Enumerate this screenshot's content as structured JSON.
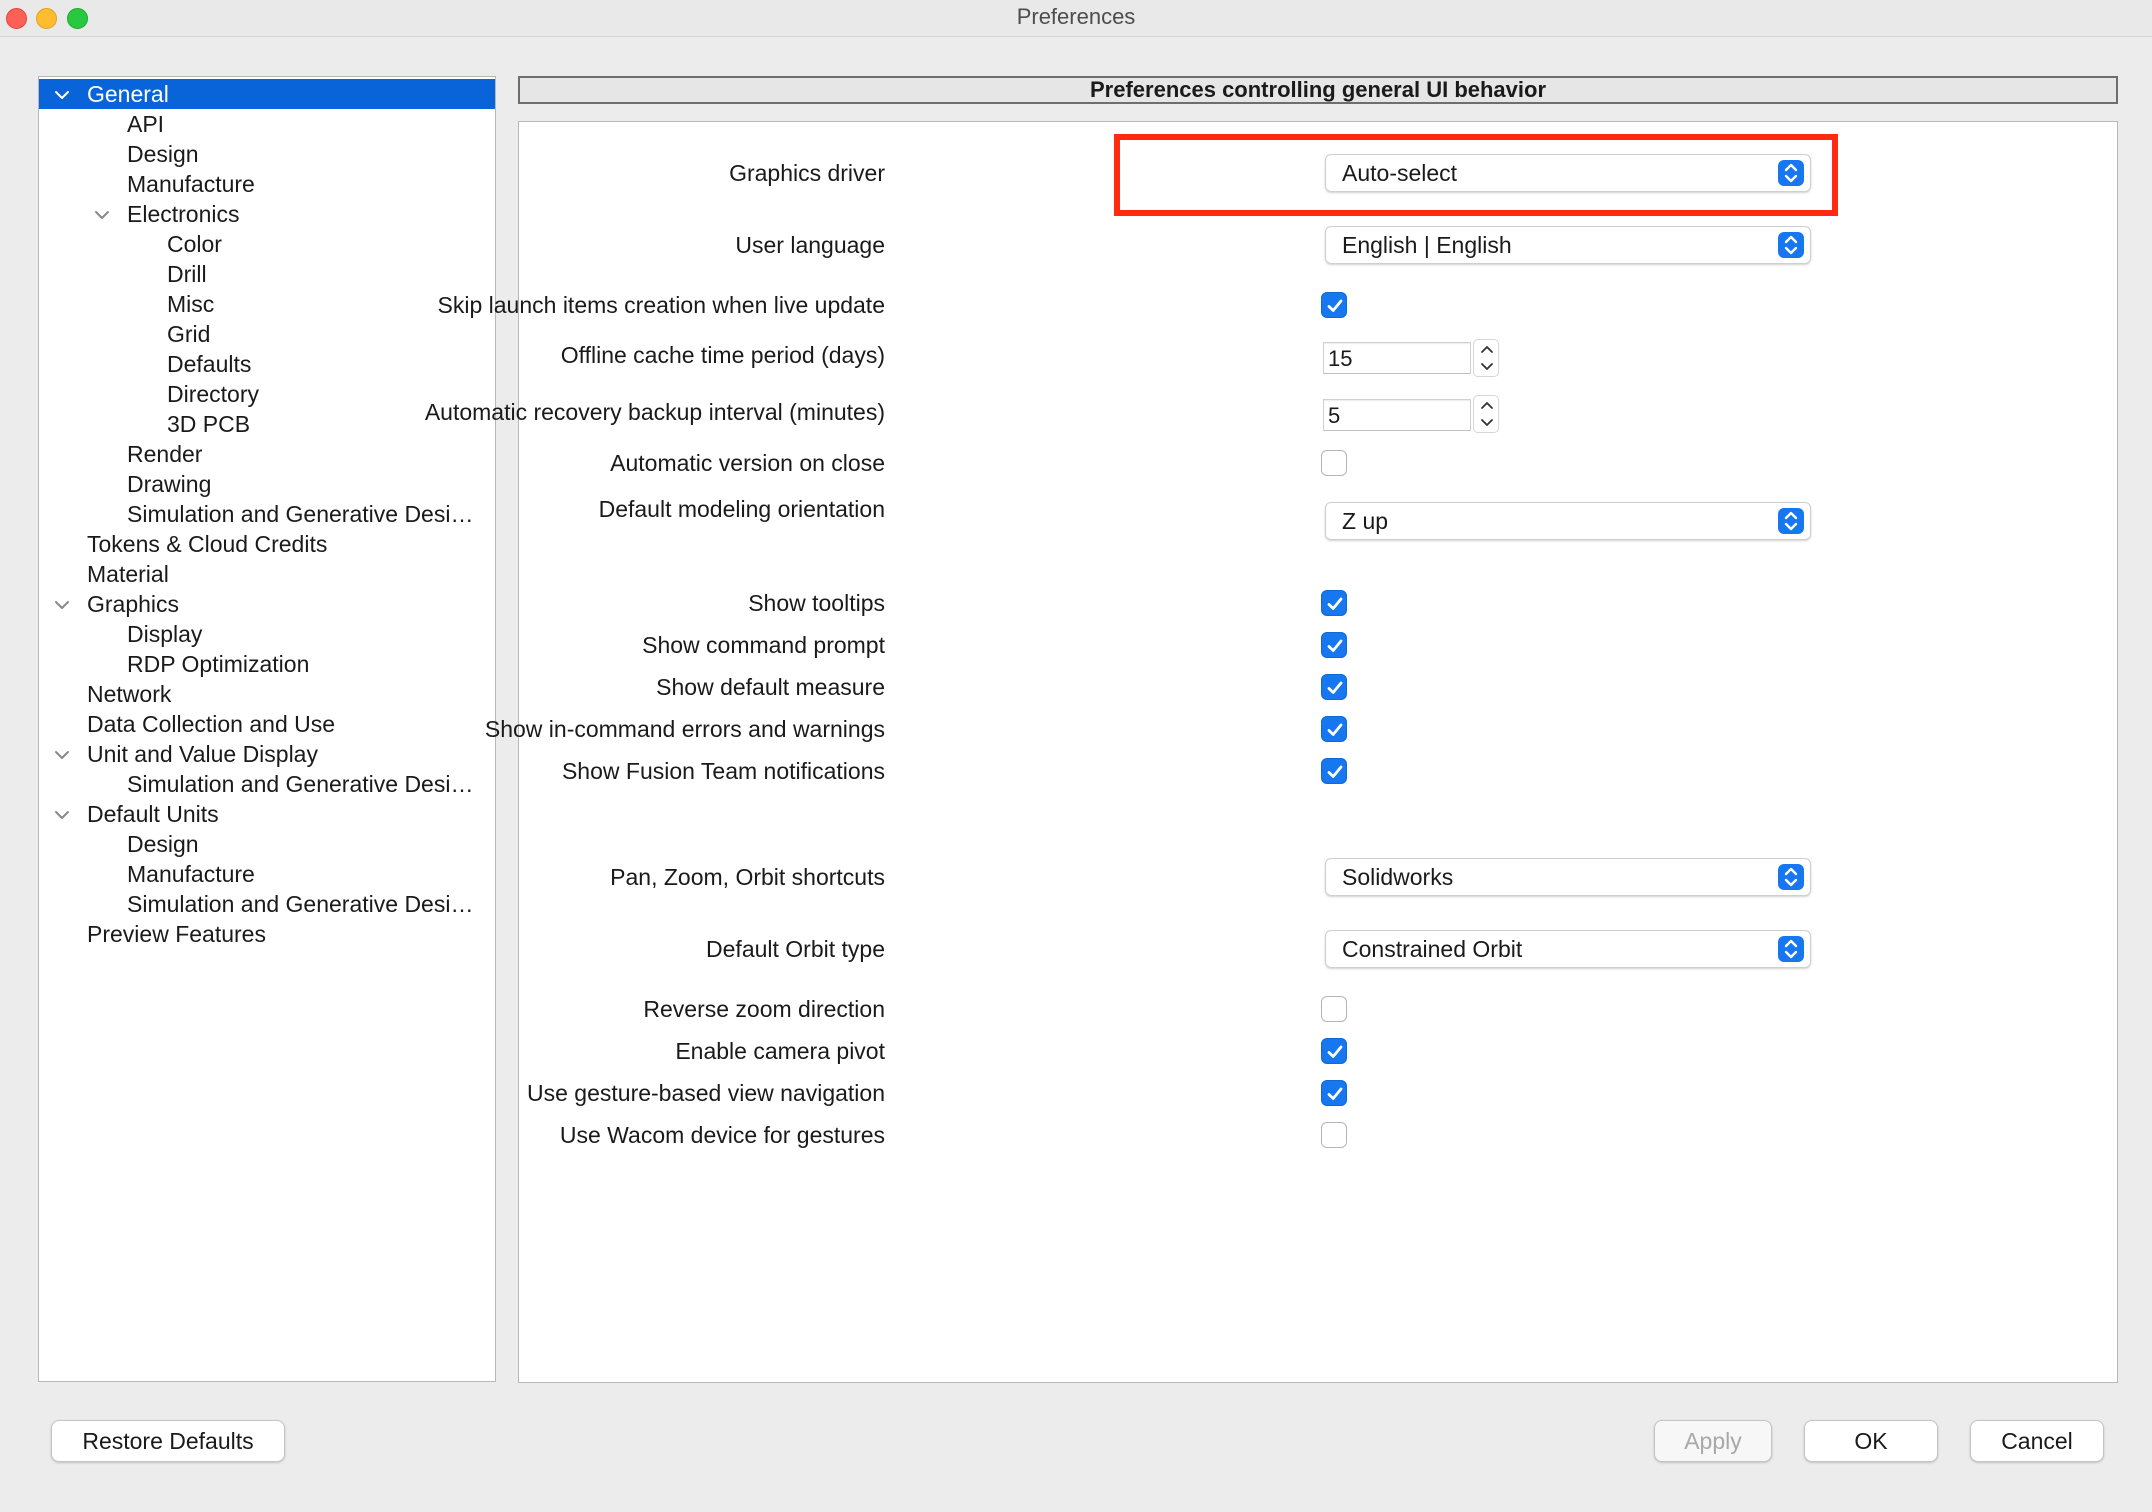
{
  "window": {
    "title": "Preferences",
    "controls": [
      "close-icon",
      "minimize-icon",
      "zoom-icon"
    ]
  },
  "tree": {
    "items": [
      {
        "label": "General",
        "level": 0,
        "expanded": true,
        "selected": true
      },
      {
        "label": "API",
        "level": 1
      },
      {
        "label": "Design",
        "level": 1
      },
      {
        "label": "Manufacture",
        "level": 1
      },
      {
        "label": "Electronics",
        "level": 1,
        "expanded": true
      },
      {
        "label": "Color",
        "level": 2
      },
      {
        "label": "Drill",
        "level": 2
      },
      {
        "label": "Misc",
        "level": 2
      },
      {
        "label": "Grid",
        "level": 2
      },
      {
        "label": "Defaults",
        "level": 2
      },
      {
        "label": "Directory",
        "level": 2
      },
      {
        "label": "3D PCB",
        "level": 2
      },
      {
        "label": "Render",
        "level": 1
      },
      {
        "label": "Drawing",
        "level": 1
      },
      {
        "label": "Simulation and Generative Desi…",
        "level": 1
      },
      {
        "label": "Tokens & Cloud Credits",
        "level": 0
      },
      {
        "label": "Material",
        "level": 0
      },
      {
        "label": "Graphics",
        "level": 0,
        "expanded": true
      },
      {
        "label": "Display",
        "level": 1
      },
      {
        "label": "RDP Optimization",
        "level": 1
      },
      {
        "label": "Network",
        "level": 0
      },
      {
        "label": "Data Collection and Use",
        "level": 0
      },
      {
        "label": "Unit and Value Display",
        "level": 0,
        "expanded": true
      },
      {
        "label": "Simulation and Generative Desi…",
        "level": 1
      },
      {
        "label": "Default Units",
        "level": 0,
        "expanded": true
      },
      {
        "label": "Design",
        "level": 1
      },
      {
        "label": "Manufacture",
        "level": 1
      },
      {
        "label": "Simulation and Generative Desi…",
        "level": 1
      },
      {
        "label": "Preview Features",
        "level": 0
      }
    ]
  },
  "panel": {
    "header": "Preferences controlling general UI behavior",
    "graphics_driver": {
      "label": "Graphics driver",
      "value": "Auto-select"
    },
    "user_language": {
      "label": "User language",
      "value": "English | English"
    },
    "skip_launch": {
      "label": "Skip launch items creation when live update",
      "checked": true
    },
    "offline_cache": {
      "label": "Offline cache time period (days)",
      "value": "15"
    },
    "recovery_interval": {
      "label": "Automatic recovery backup interval (minutes)",
      "value": "5"
    },
    "auto_version": {
      "label": "Automatic version on close",
      "checked": false
    },
    "orientation": {
      "label": "Default modeling orientation",
      "value": "Z up"
    },
    "show_tooltips": {
      "label": "Show tooltips",
      "checked": true
    },
    "show_command_prompt": {
      "label": "Show command prompt",
      "checked": true
    },
    "show_default_measure": {
      "label": "Show default measure",
      "checked": true
    },
    "show_errors": {
      "label": "Show in-command errors and warnings",
      "checked": true
    },
    "show_team_notifications": {
      "label": "Show Fusion Team notifications",
      "checked": true
    },
    "shortcuts": {
      "label": "Pan, Zoom, Orbit shortcuts",
      "value": "Solidworks"
    },
    "orbit_type": {
      "label": "Default Orbit type",
      "value": "Constrained Orbit"
    },
    "reverse_zoom": {
      "label": "Reverse zoom direction",
      "checked": false
    },
    "camera_pivot": {
      "label": "Enable camera pivot",
      "checked": true
    },
    "gesture_nav": {
      "label": "Use gesture-based view navigation",
      "checked": true
    },
    "wacom": {
      "label": "Use Wacom device for gestures",
      "checked": false
    }
  },
  "footer": {
    "restore_defaults": "Restore Defaults",
    "apply": "Apply",
    "ok": "OK",
    "cancel": "Cancel"
  },
  "colors": {
    "accent": "#1677f0",
    "selection": "#0a64d9",
    "highlight_box": "#ff2a10"
  }
}
